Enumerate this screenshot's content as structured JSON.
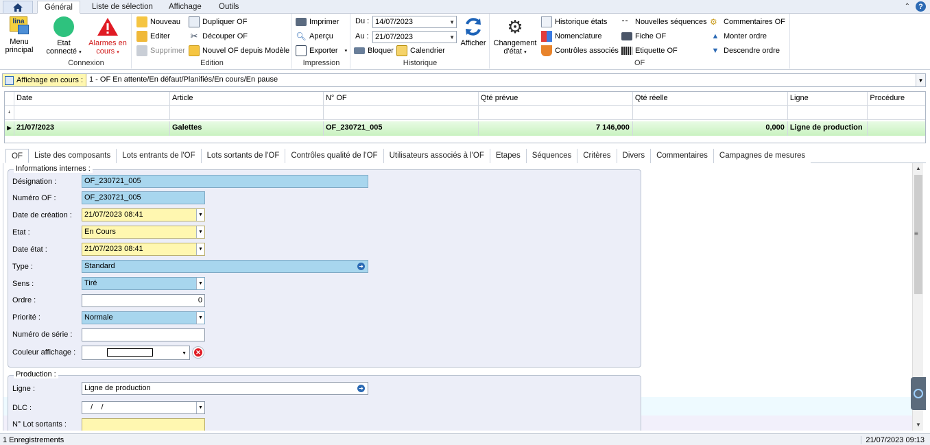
{
  "tabs": {
    "general": "Général",
    "selection": "Liste de sélection",
    "display": "Affichage",
    "tools": "Outils"
  },
  "ribbon": {
    "menu_principal": "Menu principal",
    "connexion": {
      "etat": "Etat connecté",
      "alarmes": "Alarmes en cours",
      "label": "Connexion"
    },
    "edition": {
      "nouveau": "Nouveau",
      "editer": "Editer",
      "supprimer": "Supprimer",
      "dupliquer": "Dupliquer OF",
      "decouper": "Découper OF",
      "nouvel_modele": "Nouvel OF depuis Modèle",
      "label": "Edition"
    },
    "impression": {
      "imprimer": "Imprimer",
      "apercu": "Aperçu",
      "exporter": "Exporter",
      "label": "Impression"
    },
    "historique": {
      "du_label": "Du :",
      "du_value": "14/07/2023",
      "au_label": "Au :",
      "au_value": "21/07/2023",
      "bloquer": "Bloquer",
      "calendrier": "Calendrier",
      "afficher": "Afficher",
      "label": "Historique"
    },
    "of": {
      "changement": "Changement d'état",
      "historique_etats": "Historique états",
      "nomenclature": "Nomenclature",
      "controles": "Contrôles associés",
      "nouvelles_sequences": "Nouvelles séquences",
      "fiche_of": "Fiche OF",
      "etiquette_of": "Etiquette OF",
      "commentaires_of": "Commentaires OF",
      "monter": "Monter ordre",
      "descendre": "Descendre ordre",
      "label": "OF"
    }
  },
  "filter": {
    "label": "Affichage en cours :",
    "value": "1 - OF En attente/En défaut/Planifiés/En cours/En pause"
  },
  "grid": {
    "columns": [
      "Date",
      "Article",
      "N° OF",
      "Qté prévue",
      "Qté réelle",
      "Ligne",
      "Procédure"
    ],
    "rows": [
      {
        "date": "21/07/2023",
        "article": "Galettes",
        "of": "OF_230721_005",
        "qte_prevue": "7 146,000",
        "qte_reelle": "0,000",
        "ligne": "Ligne de production",
        "procedure": ""
      }
    ]
  },
  "detail_tabs": [
    "OF",
    "Liste des composants",
    "Lots entrants de l'OF",
    "Lots sortants de l'OF",
    "Contrôles qualité de l'OF",
    "Utilisateurs associés à l'OF",
    "Etapes",
    "Séquences",
    "Critères",
    "Divers",
    "Commentaires",
    "Campagnes de mesures"
  ],
  "info": {
    "legend": "Informations internes :",
    "designation_label": "Désignation :",
    "designation": "OF_230721_005",
    "numero_label": "Numéro OF :",
    "numero": "OF_230721_005",
    "date_creation_label": "Date de création :",
    "date_creation": "21/07/2023  08:41",
    "etat_label": "Etat :",
    "etat": "En Cours",
    "date_etat_label": "Date état :",
    "date_etat": "21/07/2023  08:41",
    "type_label": "Type :",
    "type": "Standard",
    "sens_label": "Sens :",
    "sens": "Tiré",
    "ordre_label": "Ordre :",
    "ordre": "0",
    "priorite_label": "Priorité :",
    "priorite": "Normale",
    "serie_label": "Numéro de série :",
    "serie": "",
    "couleur_label": "Couleur affichage :"
  },
  "production": {
    "legend": "Production :",
    "ligne_label": "Ligne :",
    "ligne": "Ligne de production",
    "dlc_label": "DLC :",
    "dlc": "   /    /",
    "lot_label": "N° Lot sortants :",
    "lot": ""
  },
  "status": {
    "left": "1 Enregistrements",
    "right": "21/07/2023 09:13"
  }
}
